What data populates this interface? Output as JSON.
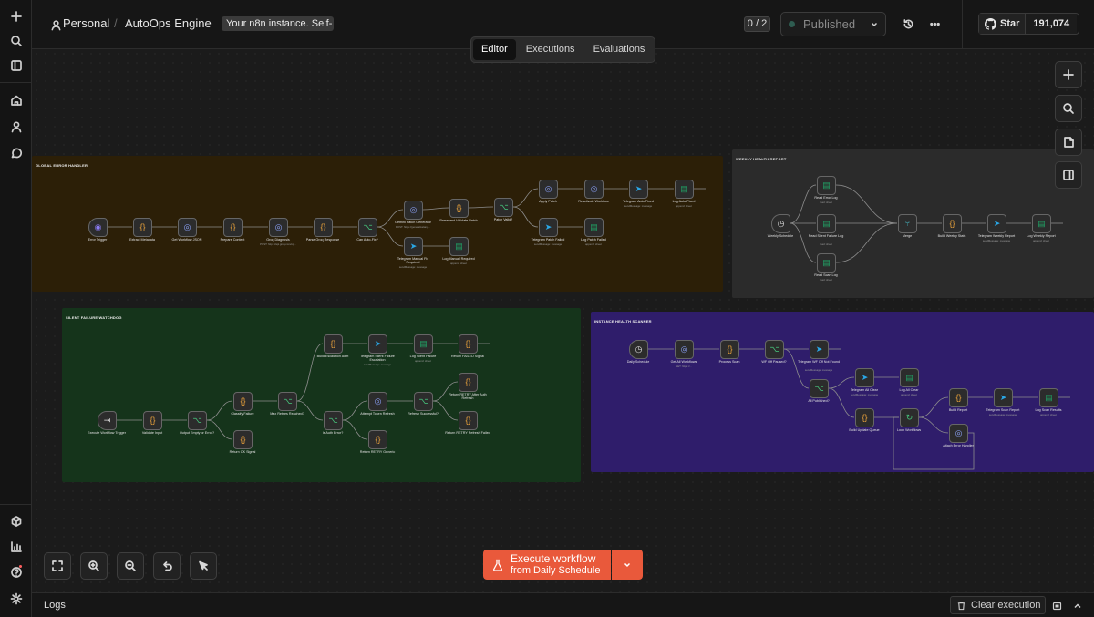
{
  "breadcrumb": {
    "project": "Personal",
    "workflow": "AutoOps Engine",
    "tag": "Your n8n instance. Self-"
  },
  "header": {
    "counter": "0 / 2",
    "publish_label": "Published",
    "github_star": "Star",
    "github_count": "191,074"
  },
  "tabs": [
    "Editor",
    "Executions",
    "Evaluations"
  ],
  "execute": {
    "label": "Execute workflow",
    "sublabel": "from Daily Schedule"
  },
  "logs": {
    "label": "Logs",
    "clear_label": "Clear execution"
  },
  "colors": {
    "error_sticky": "#2c1f07",
    "weekly_sticky": "#2b2b2b",
    "silent_sticky": "#15341b",
    "instance_sticky": "#2f1d6b",
    "execute": "#e9593b"
  },
  "icons": {
    "sidebar": [
      "plus-icon",
      "search-icon",
      "panel-icon",
      "home-icon",
      "user-icon",
      "chat-icon",
      "cube-icon",
      "chart-icon",
      "help-icon",
      "settings-icon"
    ],
    "canvas_controls": [
      "fit-view-icon",
      "zoom-in-icon",
      "zoom-out-icon",
      "undo-icon",
      "cursor-icon"
    ]
  },
  "stickies": [
    {
      "title": "GLOBAL ERROR HANDLER"
    },
    {
      "title": "WEEKLY HEALTH REPORT"
    },
    {
      "title": "SILENT FAILURE WATCHDOG"
    },
    {
      "title": "INSTANCE HEALTH SCANNER"
    }
  ],
  "nodes": [
    {
      "label": "Error Trigger",
      "sub": "",
      "icon": "trigger"
    },
    {
      "label": "Extract Metadata",
      "sub": "",
      "icon": "code"
    },
    {
      "label": "Get Workflow JSON",
      "sub": "",
      "icon": "http"
    },
    {
      "label": "Prepare Context",
      "sub": "",
      "icon": "code"
    },
    {
      "label": "Groq Diagnosis",
      "sub": "POST: https://api.groq.com/op...",
      "icon": "http"
    },
    {
      "label": "Parse Groq Response",
      "sub": "",
      "icon": "code"
    },
    {
      "label": "Can Auto-Fix?",
      "sub": "",
      "icon": "if"
    },
    {
      "label": "Gemini Patch Generator",
      "sub": "POST: https://generativelang...",
      "icon": "http"
    },
    {
      "label": "Telegram Manual Fix Required",
      "sub": "sendMessage: message",
      "icon": "telegram"
    },
    {
      "label": "Parse and Validate Patch",
      "sub": "",
      "icon": "code"
    },
    {
      "label": "Log Manual Required",
      "sub": "append: sheet",
      "icon": "sheets"
    },
    {
      "label": "Patch Valid?",
      "sub": "",
      "icon": "if"
    },
    {
      "label": "Apply Patch",
      "sub": "",
      "icon": "http"
    },
    {
      "label": "Telegram Patch Failed",
      "sub": "sendMessage: message",
      "icon": "telegram"
    },
    {
      "label": "Reactivate Workflow",
      "sub": "",
      "icon": "http"
    },
    {
      "label": "Log Patch Failed",
      "sub": "append: sheet",
      "icon": "sheets"
    },
    {
      "label": "Telegram Auto-Fixed",
      "sub": "sendMessage: message",
      "icon": "telegram"
    },
    {
      "label": "Log Auto-Fixed",
      "sub": "append: sheet",
      "icon": "sheets"
    },
    {
      "label": "Weekly Schedule",
      "sub": "",
      "icon": "schedule"
    },
    {
      "label": "Read Error Log",
      "sub": "read: sheet",
      "icon": "sheets"
    },
    {
      "label": "Read Silent Failure Log",
      "sub": "read: sheet",
      "icon": "sheets"
    },
    {
      "label": "Read Scan Log",
      "sub": "read: sheet",
      "icon": "sheets"
    },
    {
      "label": "Merge",
      "sub": "",
      "icon": "merge"
    },
    {
      "label": "Build Weekly Stats",
      "sub": "",
      "icon": "code"
    },
    {
      "label": "Telegram Weekly Report",
      "sub": "sendMessage: message",
      "icon": "telegram"
    },
    {
      "label": "Log Weekly Report",
      "sub": "append: sheet",
      "icon": "sheets"
    },
    {
      "label": "Execute Workflow Trigger",
      "sub": "",
      "icon": "exec"
    },
    {
      "label": "Validate Input",
      "sub": "",
      "icon": "code"
    },
    {
      "label": "Output Empty or Error?",
      "sub": "",
      "icon": "if"
    },
    {
      "label": "Classify Failure",
      "sub": "",
      "icon": "code"
    },
    {
      "label": "Return OK Signal",
      "sub": "",
      "icon": "code"
    },
    {
      "label": "Max Retries Reached?",
      "sub": "",
      "icon": "if"
    },
    {
      "label": "Build Escalation Alert",
      "sub": "",
      "icon": "code"
    },
    {
      "label": "Is Auth Error?",
      "sub": "",
      "icon": "if"
    },
    {
      "label": "Telegram Silent Failure Escalation",
      "sub": "sendMessage: message",
      "icon": "telegram"
    },
    {
      "label": "Log Silent Failure",
      "sub": "append: sheet",
      "icon": "sheets"
    },
    {
      "label": "Return FAILED Signal",
      "sub": "",
      "icon": "code"
    },
    {
      "label": "Attempt Token Refresh",
      "sub": "",
      "icon": "http"
    },
    {
      "label": "Return RETRY Generic",
      "sub": "",
      "icon": "code"
    },
    {
      "label": "Refresh Successful?",
      "sub": "",
      "icon": "if"
    },
    {
      "label": "Return RETRY After Auth Refresh",
      "sub": "",
      "icon": "code"
    },
    {
      "label": "Return RETRY Refresh Failed",
      "sub": "",
      "icon": "code"
    },
    {
      "label": "Daily Schedule",
      "sub": "",
      "icon": "schedule"
    },
    {
      "label": "Get All Workflows",
      "sub": "GET: https://...",
      "icon": "http"
    },
    {
      "label": "Process Scan",
      "sub": "",
      "icon": "code"
    },
    {
      "label": "WF Off Paused?",
      "sub": "",
      "icon": "if"
    },
    {
      "label": "Telegram WF Off Not Found",
      "sub": "sendMessage: message",
      "icon": "telegram"
    },
    {
      "label": "All Published?",
      "sub": "",
      "icon": "if"
    },
    {
      "label": "Telegram All Clear",
      "sub": "sendMessage: message",
      "icon": "telegram"
    },
    {
      "label": "Build Update Queue",
      "sub": "",
      "icon": "code"
    },
    {
      "label": "Log All Clear",
      "sub": "append: sheet",
      "icon": "sheets"
    },
    {
      "label": "Loop Workflows",
      "sub": "",
      "icon": "loop"
    },
    {
      "label": "Build Report",
      "sub": "",
      "icon": "code"
    },
    {
      "label": "Attach Error Handler",
      "sub": "",
      "icon": "http"
    },
    {
      "label": "Telegram Scan Report",
      "sub": "sendMessage: message",
      "icon": "telegram"
    },
    {
      "label": "Log Scan Results",
      "sub": "append: sheet",
      "icon": "sheets"
    }
  ]
}
